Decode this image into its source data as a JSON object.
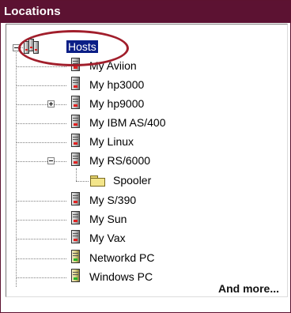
{
  "panel": {
    "title": "Locations",
    "more_label": "And more..."
  },
  "tree": {
    "root": {
      "label": "Hosts",
      "expanded": true,
      "selected": true,
      "icon": "server-group-icon"
    },
    "items": [
      {
        "label": "My Aviion",
        "icon": "server-icon"
      },
      {
        "label": "My hp3000",
        "icon": "server-icon"
      },
      {
        "label": "My hp9000",
        "icon": "server-icon",
        "expander": "plus"
      },
      {
        "label": "My IBM AS/400",
        "icon": "server-icon"
      },
      {
        "label": "My Linux",
        "icon": "server-icon"
      },
      {
        "label": "My RS/6000",
        "icon": "server-icon",
        "expander": "minus"
      },
      {
        "label": "Spooler",
        "icon": "folder-icon",
        "child": true
      },
      {
        "label": "My S/390",
        "icon": "server-icon"
      },
      {
        "label": "My Sun",
        "icon": "server-icon"
      },
      {
        "label": "My Vax",
        "icon": "server-icon"
      },
      {
        "label": "Networkd PC",
        "icon": "pc-icon"
      },
      {
        "label": "Windows PC",
        "icon": "pc-icon"
      }
    ]
  },
  "colors": {
    "title_bg": "#5c1232",
    "selection_bg": "#0a1e86",
    "highlight_oval": "#a11e2b"
  }
}
